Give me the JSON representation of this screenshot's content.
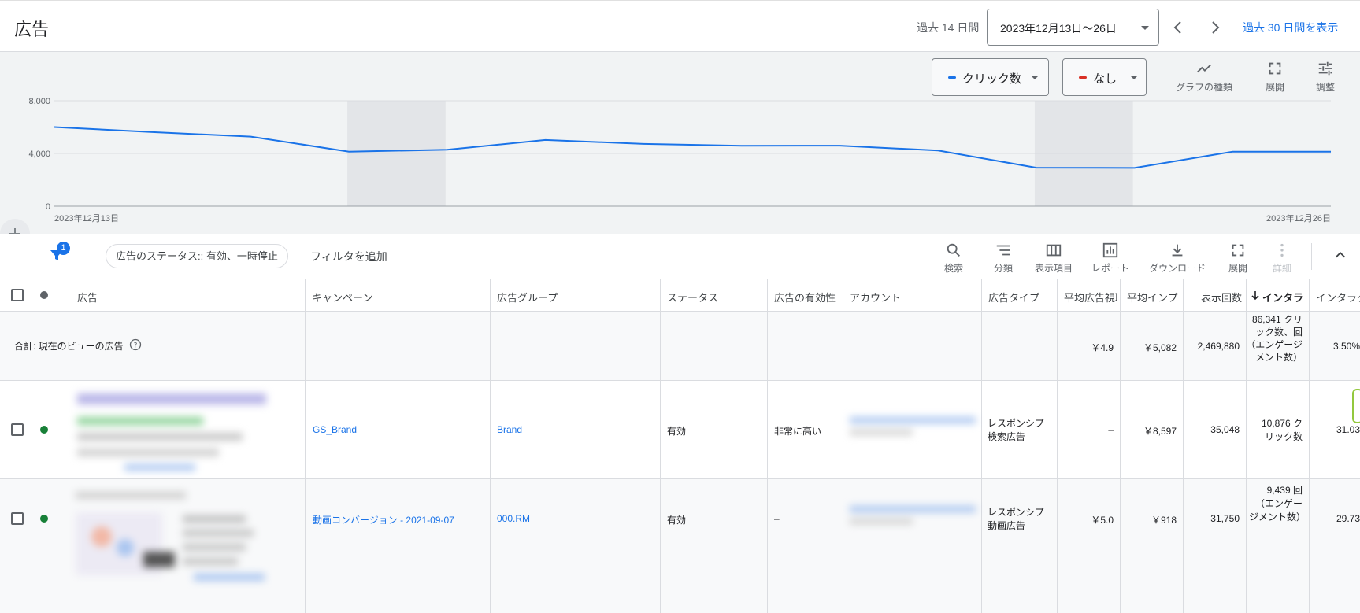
{
  "header": {
    "title": "広告",
    "period_label": "過去 14 日間",
    "date_range": "2023年12月13日〜26日",
    "show_30_days": "過去 30 日間を表示"
  },
  "chart_controls": {
    "metric1": {
      "label": "クリック数",
      "color": "#1a73e8"
    },
    "metric2": {
      "label": "なし",
      "color": "#d93025"
    },
    "graph_type": "グラフの種類",
    "expand": "展開",
    "adjust": "調整"
  },
  "chart_data": {
    "type": "line",
    "x": [
      "2023-12-13",
      "2023-12-14",
      "2023-12-15",
      "2023-12-16",
      "2023-12-17",
      "2023-12-18",
      "2023-12-19",
      "2023-12-20",
      "2023-12-21",
      "2023-12-22",
      "2023-12-23",
      "2023-12-24",
      "2023-12-25",
      "2023-12-26"
    ],
    "x_tick_labels": [
      "2023年12月13日",
      "2023年12月26日"
    ],
    "series": [
      {
        "values": [
          6000,
          5620,
          5280,
          4140,
          4280,
          5020,
          4720,
          4580,
          4590,
          4220,
          2920,
          2900,
          4140,
          4140
        ]
      }
    ],
    "y_ticks": [
      "8,000",
      "4,000",
      "0"
    ],
    "ylim": [
      0,
      8000
    ],
    "shaded_days": [
      "2023-12-16",
      "2023-12-23"
    ],
    "line_color": "#1a73e8"
  },
  "filter_bar": {
    "badge": "1",
    "chip": "広告のステータス:: 有効、一時停止",
    "add_filter": "フィルタを追加",
    "tools": [
      "検索",
      "分類",
      "表示項目",
      "レポート",
      "ダウンロード",
      "展開",
      "詳細"
    ]
  },
  "table": {
    "headers": [
      "広告",
      "キャンペーン",
      "広告グループ",
      "ステータス",
      "広告の有効性",
      "アカウント",
      "広告タイプ",
      "平均広告視聴",
      "平均インプレ",
      "表示回数",
      "インタラ",
      "インタラク"
    ],
    "total": {
      "label": "合計: 現在のビューの広告",
      "avg_view": "￥4.9",
      "avg_imp": "￥5,082",
      "impressions": "2,469,880",
      "interactions": "86,341 クリック数、回（エンゲージメント数）",
      "rate": "3.50%"
    },
    "rows": [
      {
        "campaign": "GS_Brand",
        "ad_group": "Brand",
        "status": "有効",
        "strength": "非常に高い",
        "ad_type": "レスポンシブ 検索広告",
        "avg_view": "–",
        "avg_imp": "￥8,597",
        "impressions": "35,048",
        "interactions": "10,876 クリック数",
        "rate": "31.03"
      },
      {
        "campaign": "動画コンバージョン - 2021-09-07",
        "ad_group": "000.RM",
        "status": "有効",
        "strength": "–",
        "ad_type": "レスポンシブ 動画広告",
        "avg_view": "￥5.0",
        "avg_imp": "￥918",
        "impressions": "31,750",
        "interactions": "9,439 回（エンゲージメント数）",
        "rate": "29.73"
      }
    ]
  }
}
